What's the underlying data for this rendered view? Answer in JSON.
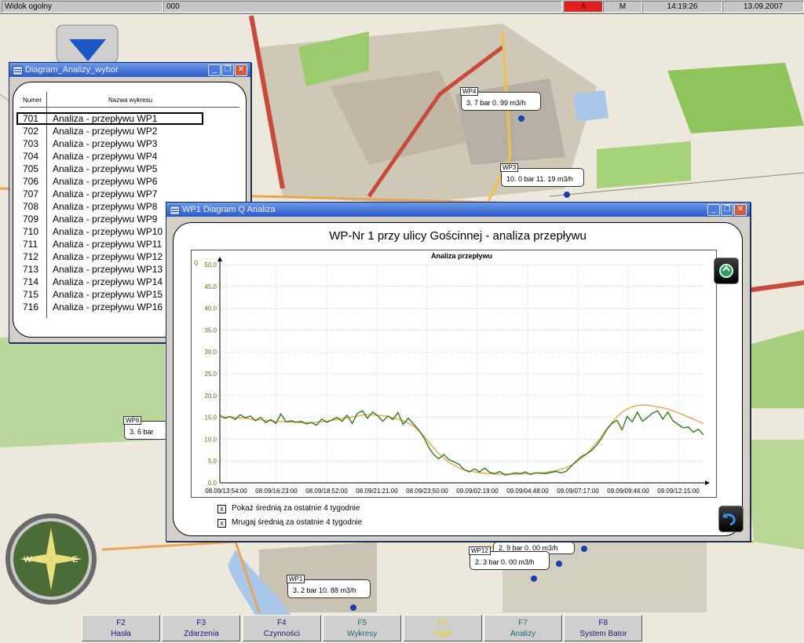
{
  "statusbar": {
    "view_name": "Widok ogolny",
    "counter": "000",
    "alarm": "A",
    "mode": "M",
    "time": "14:19:26",
    "date": "13.09.2007"
  },
  "list_window": {
    "title": "Diagram_Analizy_wybor",
    "col_number": "Numer",
    "col_name": "Nazwa wykresu",
    "rows": [
      {
        "num": "701",
        "name": "Analiza - przepływu WP1"
      },
      {
        "num": "702",
        "name": "Analiza - przepływu WP2"
      },
      {
        "num": "703",
        "name": "Analiza - przepływu WP3"
      },
      {
        "num": "704",
        "name": "Analiza - przepływu WP4"
      },
      {
        "num": "705",
        "name": "Analiza - przepływu WP5"
      },
      {
        "num": "706",
        "name": "Analiza - przepływu WP6"
      },
      {
        "num": "707",
        "name": "Analiza - przepływu WP7"
      },
      {
        "num": "708",
        "name": "Analiza - przepływu WP8"
      },
      {
        "num": "709",
        "name": "Analiza - przepływu WP9"
      },
      {
        "num": "710",
        "name": "Analiza - przepływu WP10"
      },
      {
        "num": "711",
        "name": "Analiza - przepływu WP11"
      },
      {
        "num": "712",
        "name": "Analiza - przepływu WP12"
      },
      {
        "num": "713",
        "name": "Analiza - przepływu WP13"
      },
      {
        "num": "714",
        "name": "Analiza - przepływu WP14"
      },
      {
        "num": "715",
        "name": "Analiza - przepływu WP15"
      },
      {
        "num": "716",
        "name": "Analiza - przepływu WP16"
      }
    ]
  },
  "diagram_window": {
    "title": "WP1 Diagram Q Analiza",
    "heading": "WP-Nr 1 przy ulicy Gościnnej - analiza przepływu",
    "checkbox_avg": "Pokaż średnią za ostatnie 4 tygodnie",
    "checkbox_blink": "Mrugaj średnią za ostatnie 4 tygodnie",
    "checkbox_avg_mark": "x",
    "checkbox_blink_mark": "x"
  },
  "chart_data": {
    "type": "line",
    "title": "Analiza przepływu",
    "ylabel": "Q",
    "xlabel": "",
    "ylim": [
      0,
      50
    ],
    "yticks": [
      "0.0",
      "5.0",
      "10.0",
      "15.0",
      "20.0",
      "25.0",
      "30.0",
      "35.0",
      "40.0",
      "45.0",
      "50.0"
    ],
    "xticks": [
      "08.09/13:54:00",
      "08.09/16:23:00",
      "08.09/18:52:00",
      "08.09/21:21:00",
      "08.09/23:50:00",
      "09.09/02:19:00",
      "09.09/04:48:00",
      "09.09/07:17:00",
      "09.09/09:46:00",
      "09.09/12:15:00"
    ],
    "grid": true,
    "colors": {
      "series_current": "#2e7d1a",
      "series_average": "#f0a24a"
    },
    "series": [
      {
        "role": "current",
        "values": [
          15.5,
          14.8,
          15.2,
          14.5,
          15.6,
          14.9,
          15.3,
          14.2,
          15.0,
          13.8,
          14.5,
          13.6,
          15.8,
          14.0,
          14.2,
          13.9,
          14.1,
          13.5,
          13.8,
          13.2,
          14.6,
          13.9,
          14.4,
          15.0,
          14.1,
          15.5,
          13.6,
          15.9,
          16.5,
          14.8,
          16.2,
          15.4,
          14.1,
          15.3,
          14.5,
          16.1,
          13.4,
          14.8,
          13.5,
          12.2,
          10.5,
          8.2,
          6.5,
          5.5,
          6.5,
          5.3,
          4.8,
          4.2,
          3.0,
          2.5,
          3.2,
          2.5,
          3.4,
          2.4,
          2.1,
          2.6,
          1.8,
          2.0,
          2.3,
          2.1,
          2.5,
          1.9,
          2.3,
          2.2,
          2.1,
          2.4,
          2.6,
          2.3,
          2.6,
          3.8,
          5.0,
          6.0,
          6.6,
          7.4,
          8.6,
          10.2,
          12.2,
          13.6,
          14.3,
          12.2,
          15.2,
          14.0,
          16.2,
          14.1,
          15.0,
          16.0,
          16.5,
          14.6,
          16.2,
          14.2,
          13.4,
          12.6,
          12.8,
          11.6,
          12.3,
          11.0
        ]
      },
      {
        "role": "average",
        "values": [
          15.0,
          15.0,
          15.1,
          15.0,
          14.9,
          14.8,
          14.6,
          14.5,
          14.4,
          14.3,
          14.2,
          14.1,
          14.0,
          14.0,
          13.9,
          13.9,
          13.8,
          13.8,
          13.8,
          13.9,
          14.0,
          14.1,
          14.3,
          14.5,
          14.7,
          14.9,
          15.1,
          15.3,
          15.5,
          15.6,
          15.6,
          15.5,
          15.4,
          15.2,
          14.9,
          14.6,
          14.2,
          13.7,
          13.0,
          12.0,
          10.8,
          9.4,
          8.0,
          6.7,
          5.6,
          4.7,
          4.0,
          3.4,
          3.0,
          2.7,
          2.5,
          2.3,
          2.2,
          2.1,
          2.0,
          2.0,
          2.0,
          2.0,
          2.0,
          2.0,
          2.1,
          2.1,
          2.2,
          2.3,
          2.4,
          2.6,
          2.8,
          3.1,
          3.5,
          4.0,
          4.7,
          5.6,
          6.6,
          7.8,
          9.2,
          10.7,
          12.3,
          13.8,
          15.1,
          16.2,
          16.9,
          17.4,
          17.7,
          17.8,
          17.8,
          17.6,
          17.4,
          17.2,
          16.9,
          16.5,
          16.1,
          15.6,
          15.1,
          14.6,
          14.1,
          13.6
        ]
      }
    ]
  },
  "map_labels": [
    {
      "id": "wp4",
      "name": "WP4",
      "text": "3. 7 bar    0. 99 m3/h"
    },
    {
      "id": "wp3",
      "name": "WP3",
      "text": "10. 0 bar    11. 19 m3/h"
    },
    {
      "id": "wp6",
      "name": "WP6",
      "text": "3. 6 bar"
    },
    {
      "id": "wp12",
      "name": "WP12",
      "text": "2. 3 bar    0. 00 m3/h"
    },
    {
      "id": "wp12b",
      "name": "",
      "text": "2. 9 bar    0. 00 m3/h"
    },
    {
      "id": "wp1",
      "name": "WP1",
      "text": "3. 2 bar    10. 88 m3/h"
    }
  ],
  "function_keys": [
    {
      "key": "F2",
      "label": "Hasła"
    },
    {
      "key": "F3",
      "label": "Zdarzenia"
    },
    {
      "key": "F4",
      "label": "Czynności"
    },
    {
      "key": "F5",
      "label": "Wykresy"
    },
    {
      "key": "F6",
      "label": "Pigfrl"
    },
    {
      "key": "F7",
      "label": "Analizy"
    },
    {
      "key": "F8",
      "label": "System Bator"
    }
  ]
}
